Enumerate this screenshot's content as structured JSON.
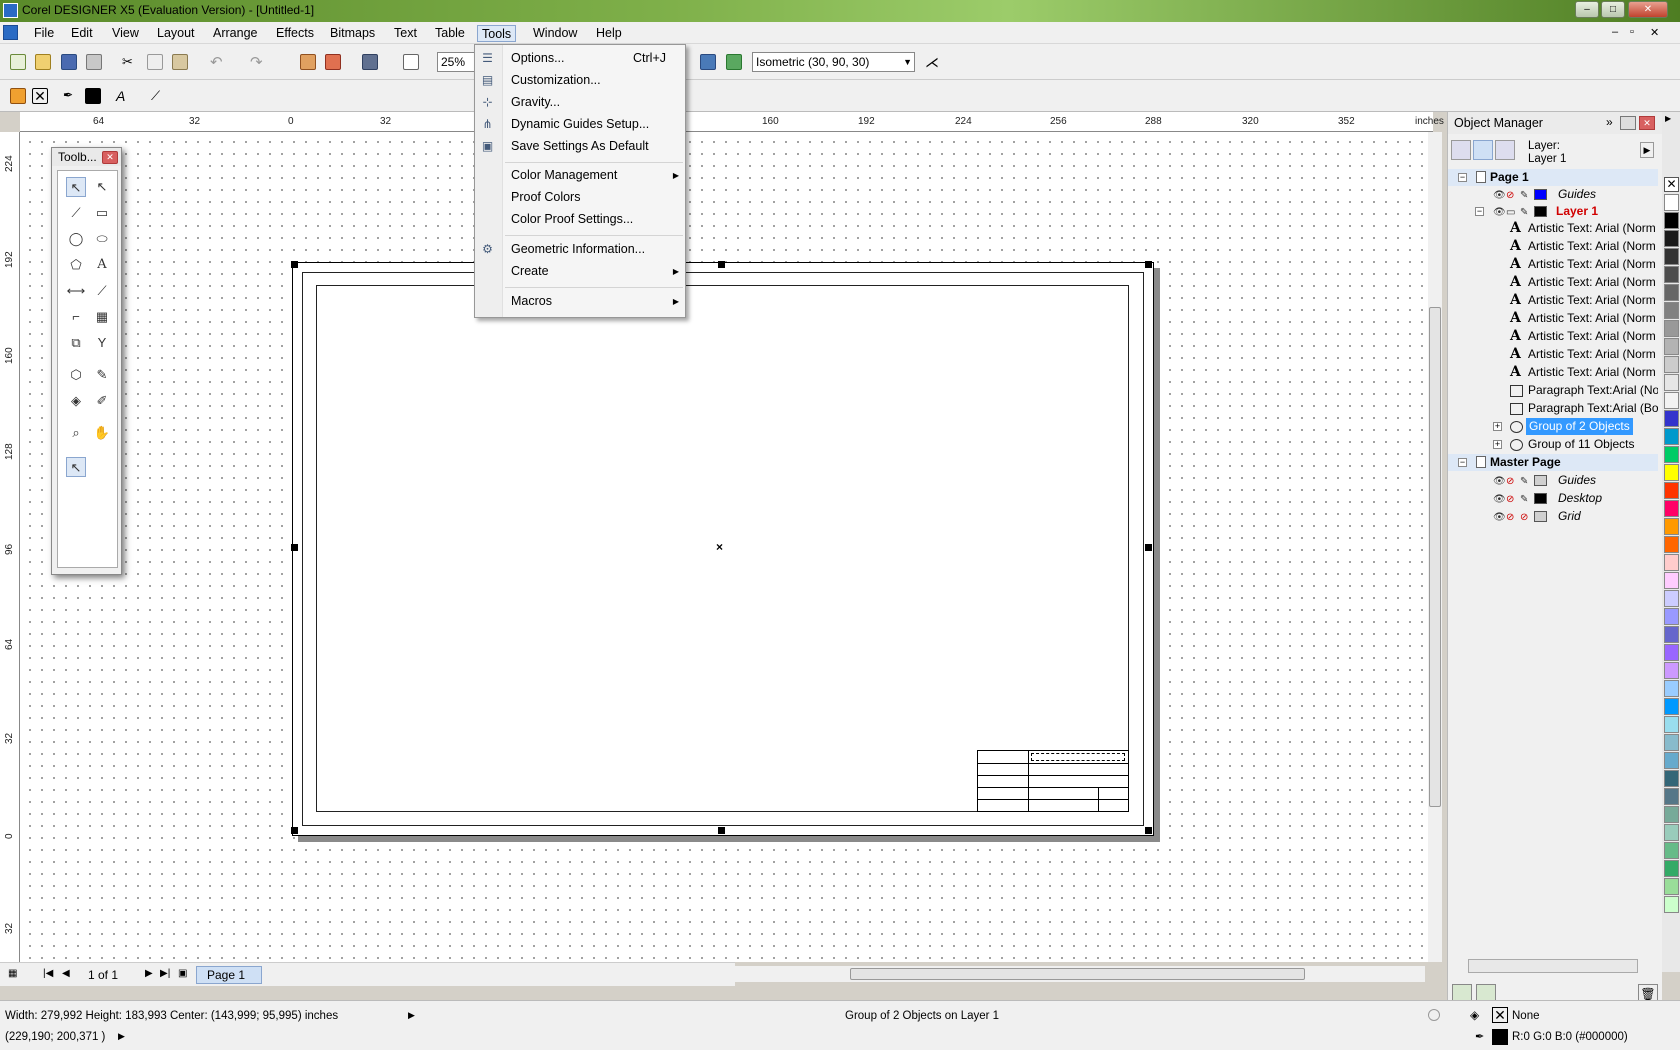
{
  "window": {
    "title": "Corel DESIGNER X5 (Evaluation Version) - [Untitled-1]"
  },
  "menubar": [
    "File",
    "Edit",
    "View",
    "Layout",
    "Arrange",
    "Effects",
    "Bitmaps",
    "Text",
    "Table",
    "Tools",
    "Window",
    "Help"
  ],
  "toolbar": {
    "zoom": "25%",
    "projection": "Isometric (30, 90, 30)"
  },
  "rulers": {
    "unit": "inches",
    "horizontal": [
      "64",
      "32",
      "0",
      "32",
      "160",
      "192",
      "224",
      "256",
      "288",
      "320",
      "352"
    ],
    "vertical": [
      "224",
      "192",
      "160",
      "128",
      "96",
      "64",
      "32",
      "0",
      "32"
    ]
  },
  "toolbox": {
    "title": "Toolb..."
  },
  "tools_menu": {
    "items": [
      {
        "label": "Options...",
        "shortcut": "Ctrl+J",
        "icon": "options-icon"
      },
      {
        "label": "Customization...",
        "icon": "customization-icon"
      },
      {
        "label": "Gravity...",
        "icon": "gravity-icon"
      },
      {
        "label": "Dynamic Guides Setup...",
        "icon": "dynamic-guides-icon"
      },
      {
        "label": "Save Settings As Default",
        "icon": "save-settings-icon"
      },
      {
        "label": "Color Management",
        "submenu": true
      },
      {
        "label": "Proof Colors"
      },
      {
        "label": "Color Proof Settings..."
      },
      {
        "label": "Geometric Information...",
        "icon": "geometric-info-icon"
      },
      {
        "label": "Create",
        "submenu": true
      },
      {
        "label": "Macros",
        "submenu": true
      }
    ]
  },
  "object_manager": {
    "title": "Object Manager",
    "layer_label": "Layer:",
    "layer_name": "Layer 1",
    "page1": "Page 1",
    "page1_layers": [
      {
        "name": "Guides",
        "color": "#0000ff"
      },
      {
        "name": "Layer 1",
        "color": "#000000"
      }
    ],
    "objects": [
      "Artistic Text: Arial (Norm",
      "Artistic Text: Arial (Norm",
      "Artistic Text: Arial (Norm",
      "Artistic Text: Arial (Norm",
      "Artistic Text: Arial (Norm",
      "Artistic Text: Arial (Norm",
      "Artistic Text: Arial (Norm",
      "Artistic Text: Arial (Norm",
      "Artistic Text: Arial (Norm",
      "Paragraph Text:Arial (No",
      "Paragraph Text:Arial (Bol",
      "Group of 2 Objects",
      "Group of 11 Objects"
    ],
    "master_page": "Master Page",
    "master_layers": [
      {
        "name": "Guides",
        "color": "#d0d0d0"
      },
      {
        "name": "Desktop",
        "color": "#000000"
      },
      {
        "name": "Grid",
        "color": "#d0d0d0"
      }
    ]
  },
  "page_nav": {
    "count": "1 of 1",
    "tab": "Page 1"
  },
  "status": {
    "dimensions": "Width: 279,992  Height: 183,993  Center: (143,999; 95,995)  inches",
    "cursor": "(229,190; 200,371 )",
    "selection": "Group of 2 Objects on Layer 1",
    "fill": "None",
    "outline": "R:0 G:0 B:0 (#000000)"
  },
  "palette": [
    "#ffffff",
    "#000000",
    "#1a1a1a",
    "#333333",
    "#4d4d4d",
    "#666666",
    "#808080",
    "#999999",
    "#b3b3b3",
    "#cccccc",
    "#e6e6e6",
    "#f2f2f2",
    "#3333cc",
    "#0099cc",
    "#00cc66",
    "#ffff00",
    "#ff3300",
    "#ff0066",
    "#ff9900",
    "#ff6600",
    "#ffcccc",
    "#ffccff",
    "#ccccff",
    "#9999ff",
    "#6666cc",
    "#9966ff",
    "#cc99ff",
    "#99ccff",
    "#0099ff",
    "#99ddee",
    "#88bbcc",
    "#66aacc",
    "#336677",
    "#557788",
    "#77aa99",
    "#99ccbb",
    "#66bb88",
    "#33aa66",
    "#99dd99",
    "#ccffcc"
  ]
}
